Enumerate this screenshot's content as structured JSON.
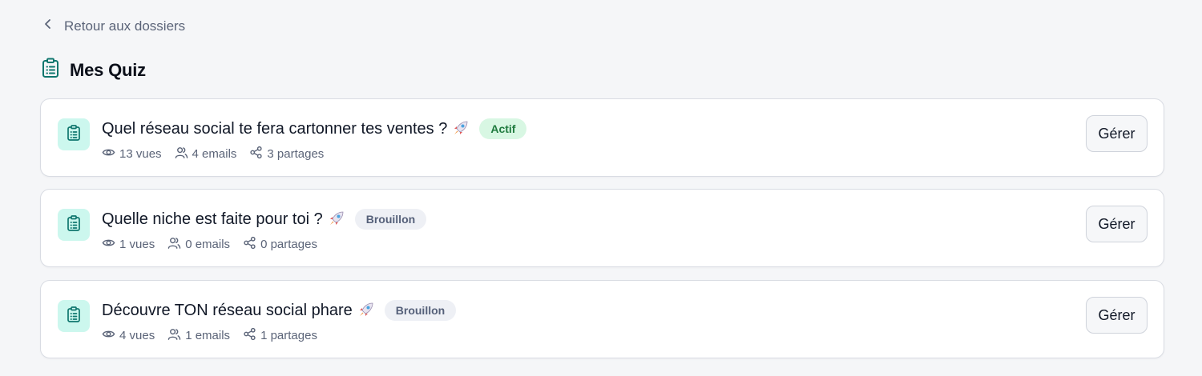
{
  "nav": {
    "back_label": "Retour aux dossiers"
  },
  "header": {
    "title": "Mes Quiz"
  },
  "colors": {
    "accent": "#0f766e",
    "icon_bg": "#ccf7ee",
    "badge_actif_bg": "#d8f7e3",
    "badge_actif_text": "#1f7a3e",
    "badge_brouillon_bg": "#eef0f5",
    "badge_brouillon_text": "#556079"
  },
  "quizzes": [
    {
      "title": "Quel réseau social te fera cartonner tes ventes ?",
      "emoji": "rocket",
      "status": "Actif",
      "views": "13 vues",
      "emails": "4 emails",
      "shares": "3 partages",
      "action_label": "Gérer"
    },
    {
      "title": "Quelle niche est faite pour toi ?",
      "emoji": "rocket",
      "status": "Brouillon",
      "views": "1 vues",
      "emails": "0 emails",
      "shares": "0 partages",
      "action_label": "Gérer"
    },
    {
      "title": "Découvre TON réseau social phare",
      "emoji": "rocket",
      "status": "Brouillon",
      "views": "4 vues",
      "emails": "1 emails",
      "shares": "1 partages",
      "action_label": "Gérer"
    }
  ]
}
